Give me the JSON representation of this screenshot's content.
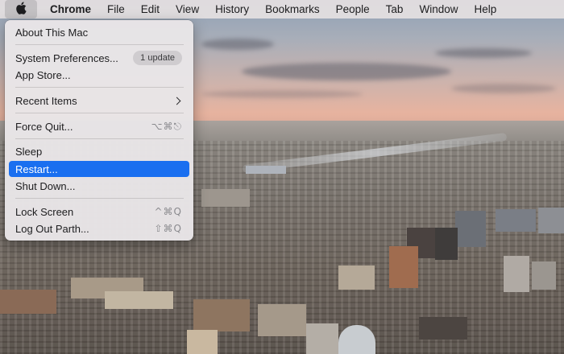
{
  "menubar": {
    "apple_icon": "apple-logo-icon",
    "app_name": "Chrome",
    "menus": [
      "File",
      "Edit",
      "View",
      "History",
      "Bookmarks",
      "People",
      "Tab",
      "Window",
      "Help"
    ]
  },
  "apple_menu": {
    "about": "About This Mac",
    "system_prefs": "System Preferences...",
    "system_prefs_badge": "1 update",
    "app_store": "App Store...",
    "recent_items": "Recent Items",
    "recent_items_icon": "chevron-right-icon",
    "force_quit": "Force Quit...",
    "force_quit_shortcut": "⌥⌘⎋",
    "sleep": "Sleep",
    "restart": "Restart...",
    "shut_down": "Shut Down...",
    "lock_screen": "Lock Screen",
    "lock_screen_shortcut": "^⌘Q",
    "log_out": "Log Out Parth...",
    "log_out_shortcut": "⇧⌘Q"
  },
  "colors": {
    "selection": "#1a6ff0",
    "menu_background": "#e8e5e7"
  }
}
